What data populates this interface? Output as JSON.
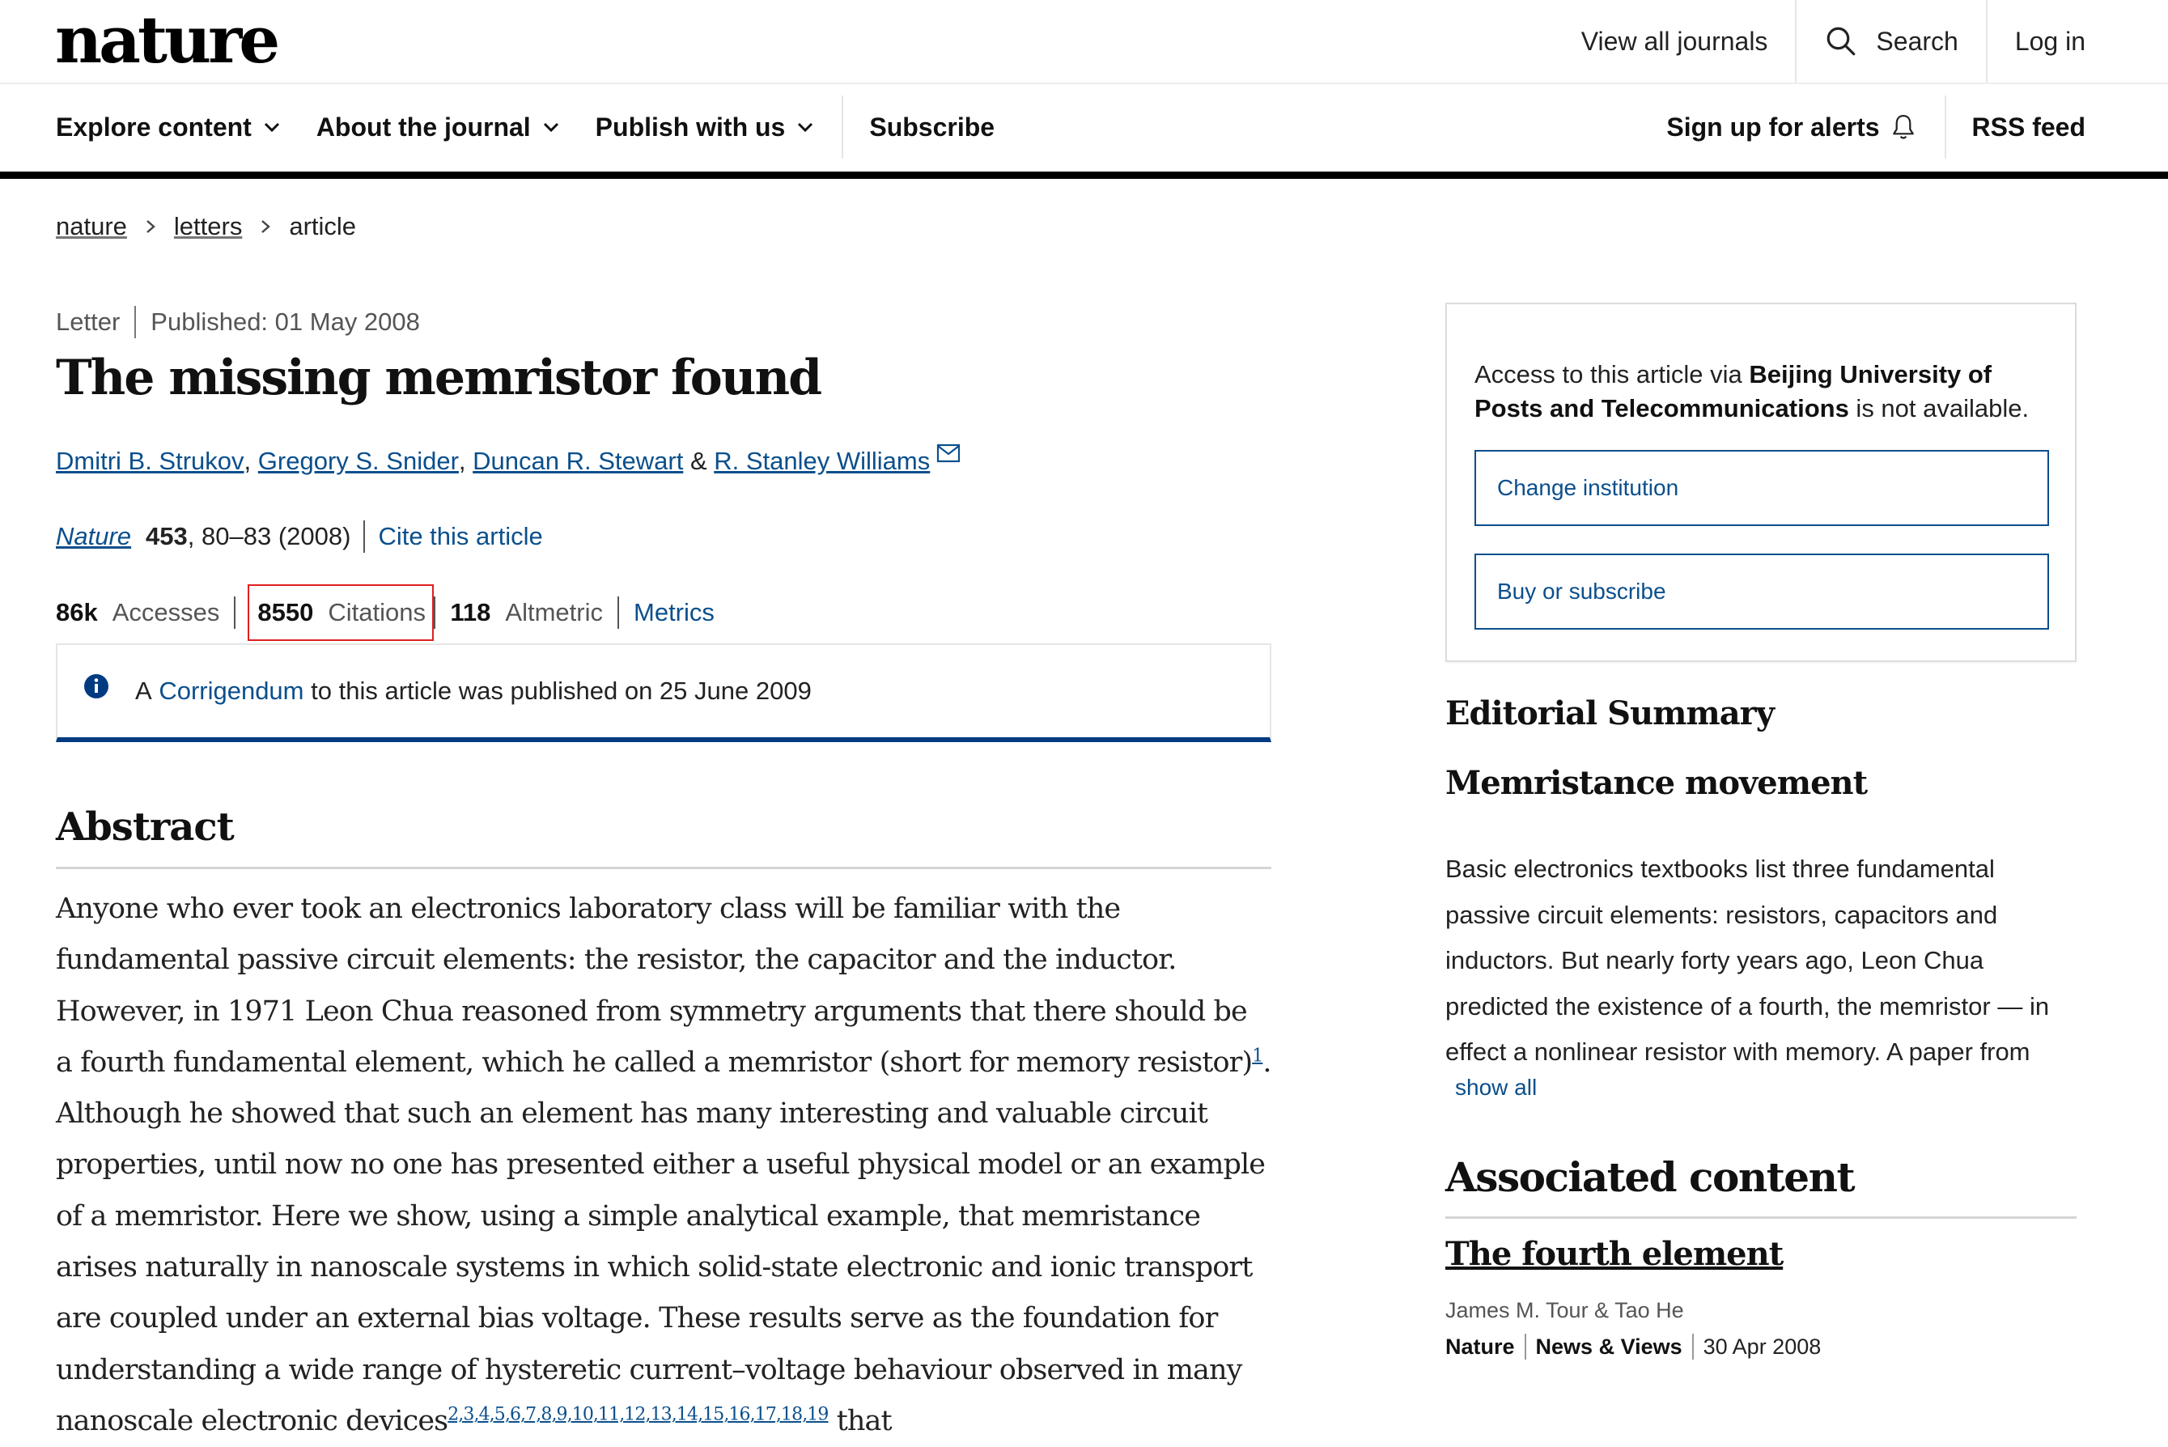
{
  "header": {
    "logo": "nature",
    "view_all_journals": "View all journals",
    "search": "Search",
    "login": "Log in"
  },
  "nav": {
    "explore": "Explore content",
    "about": "About the journal",
    "publish": "Publish with us",
    "subscribe": "Subscribe",
    "alerts": "Sign up for alerts",
    "rss": "RSS feed"
  },
  "breadcrumb": {
    "items": [
      "nature",
      "letters",
      "article"
    ]
  },
  "article": {
    "type": "Letter",
    "published": "Published: 01 May 2008",
    "title": "The missing memristor found",
    "authors": [
      "Dmitri B. Strukov",
      "Gregory S. Snider",
      "Duncan R. Stewart",
      "R. Stanley Williams"
    ],
    "author_sep": ",",
    "author_amp": "&",
    "journal": "Nature",
    "volume": "453",
    "pages": ", 80–83 (2008)",
    "cite": "Cite this article",
    "metrics": {
      "accesses_value": "86k",
      "accesses_label": "Accesses",
      "citations_value": "8550",
      "citations_label": "Citations",
      "altmetric_value": "118",
      "altmetric_label": "Altmetric",
      "metrics_link": "Metrics"
    },
    "notice": {
      "prefix": "A",
      "link": "Corrigendum",
      "suffix": "to this article was published on 25 June 2009"
    }
  },
  "abstract": {
    "heading": "Abstract",
    "part1": "Anyone who ever took an electronics laboratory class will be familiar with the fundamental passive circuit elements: the resistor, the capacitor and the inductor. However, in 1971 Leon Chua reasoned from symmetry arguments that there should be a fourth fundamental element, which he called a memristor (short for memory resistor)",
    "ref1": "1",
    "part2": ". Although he showed that such an element has many interesting and valuable circuit properties, until now no one has presented either a useful physical model or an example of a memristor. Here we show, using a simple analytical example, that memristance arises naturally in nanoscale systems in which solid-state electronic and ionic transport are coupled under an external bias voltage. These results serve as the foundation for understanding a wide range of hysteretic current–voltage behaviour observed in many nanoscale electronic devices",
    "refs": "2,3,4,5,6,7,8,9,10,11,12,13,14,15,16,17,18,19",
    "part3": " that"
  },
  "sidebar": {
    "access_prefix": "Access to this article via ",
    "access_institution": "Beijing University of Posts and Telecommunications",
    "access_suffix": " is not available.",
    "change_institution": "Change institution",
    "buy_subscribe": "Buy or subscribe",
    "editorial_heading": "Editorial Summary",
    "editorial_title": "Memristance movement",
    "editorial_text": "Basic electronics textbooks list three fundamental passive circuit elements: resistors, capacitors and inductors. But nearly forty years ago, Leon Chua predicted the existence of a fourth, the memristor — in effect a nonlinear resistor with memory. A paper from",
    "show_all": "show all",
    "associated_heading": "Associated content",
    "associated_title": "The fourth element",
    "associated_authors": "James M. Tour & Tao He",
    "associated_journal": "Nature",
    "associated_type": "News & Views",
    "associated_date": "30 Apr 2008"
  },
  "colors": {
    "link": "#0b4f8c",
    "notice_border": "#003a80",
    "highlight_box": "#e02020"
  }
}
